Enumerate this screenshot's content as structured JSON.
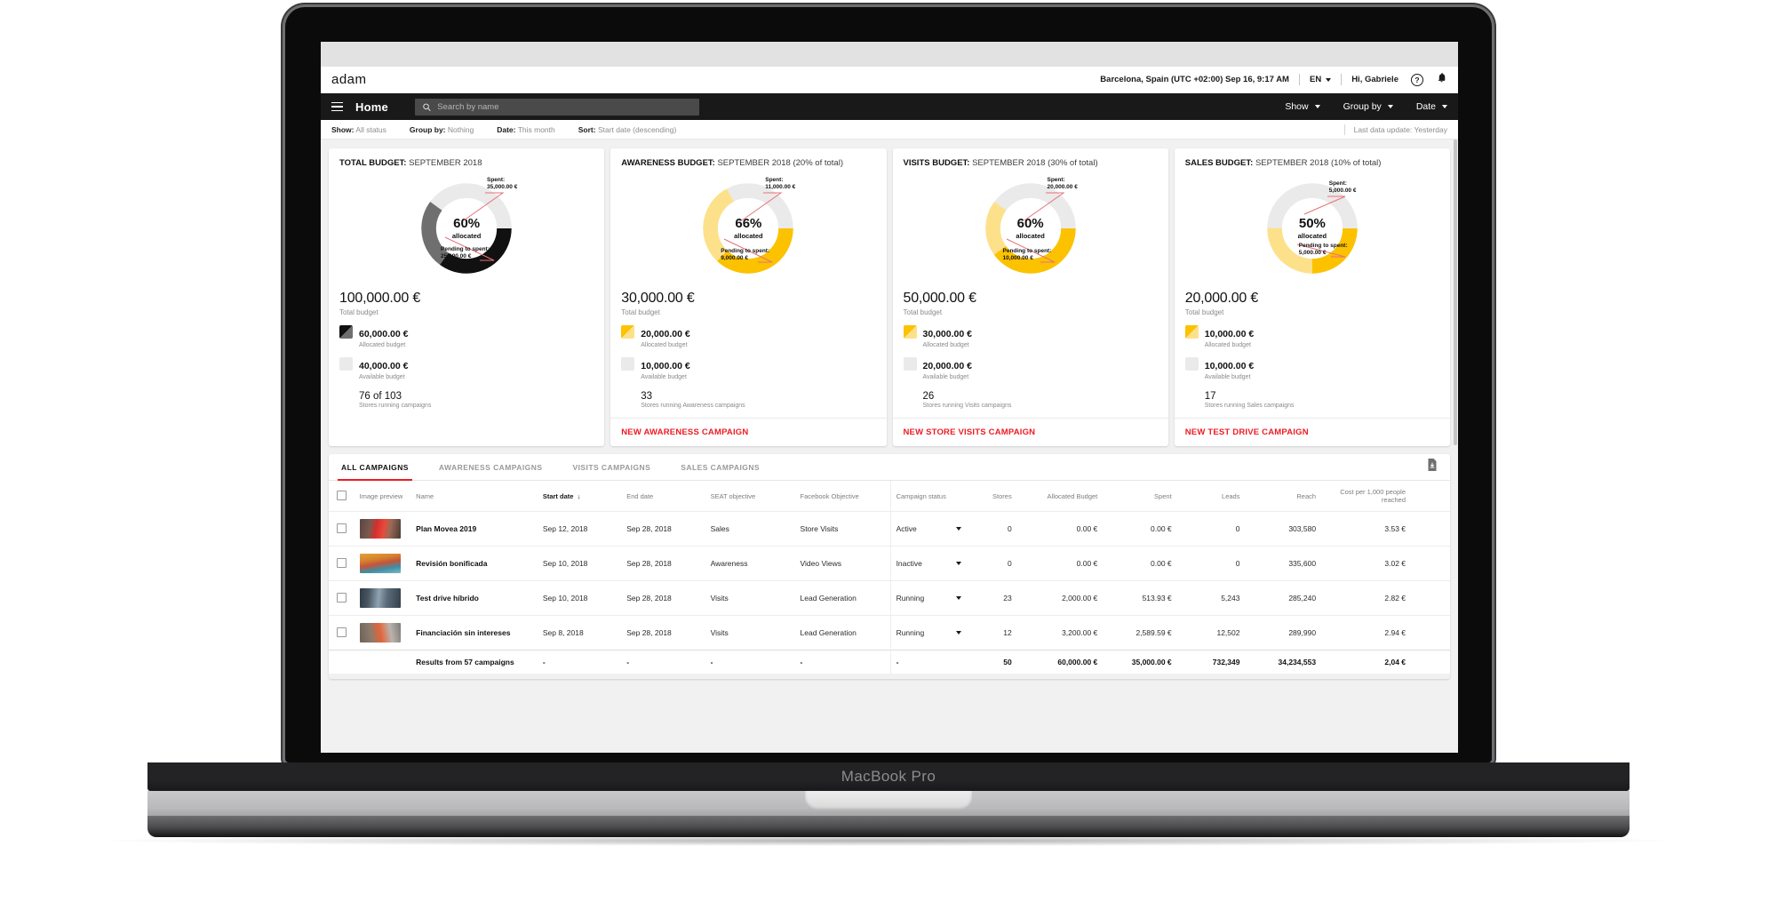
{
  "device": {
    "label": "MacBook Pro"
  },
  "brand": {
    "name": "adam"
  },
  "topbar": {
    "location_time": "Barcelona, Spain (UTC +02:00) Sep 16, 9:17 AM",
    "language": "EN",
    "greeting": "Hi, Gabriele",
    "help_icon": "question-mark-icon",
    "notifications_icon": "bell-icon"
  },
  "navbar": {
    "menu_icon": "hamburger-icon",
    "title": "Home",
    "search_placeholder": "Search by name",
    "search_value": "",
    "search_icon": "search-icon",
    "actions": [
      {
        "label": "Show"
      },
      {
        "label": "Group by"
      },
      {
        "label": "Date"
      }
    ]
  },
  "filterbar": {
    "items": [
      {
        "label": "Show:",
        "value": "All status"
      },
      {
        "label": "Group by:",
        "value": "Nothing"
      },
      {
        "label": "Date:",
        "value": "This month"
      },
      {
        "label": "Sort:",
        "value": "Start date (descending)"
      }
    ],
    "last_update": "Last data update: Yesterday"
  },
  "cards": [
    {
      "title_bold": "TOTAL BUDGET:",
      "title_rest": "SEPTEMBER 2018",
      "percent": "60%",
      "percent_sub": "allocated",
      "spent_label": "Spent:",
      "spent_value": "35,000.00 €",
      "pending_label": "Pending to spent:",
      "pending_value": "25,000.00 €",
      "total_amount": "100,000.00 €",
      "total_label": "Total budget",
      "allocated_amount": "60,000.00 €",
      "allocated_label": "Allocated budget",
      "available_amount": "40,000.00 €",
      "available_label": "Available budget",
      "stores_value": "76 of 103",
      "stores_label": "Stores running campaigns",
      "cta": "",
      "theme": "dark"
    },
    {
      "title_bold": "AWARENESS BUDGET:",
      "title_rest": "SEPTEMBER 2018 (20% of total)",
      "percent": "66%",
      "percent_sub": "allocated",
      "spent_label": "Spent:",
      "spent_value": "11,000.00 €",
      "pending_label": "Pending to spent:",
      "pending_value": "9,000.00 €",
      "total_amount": "30,000.00 €",
      "total_label": "Total budget",
      "allocated_amount": "20,000.00 €",
      "allocated_label": "Allocated budget",
      "available_amount": "10,000.00 €",
      "available_label": "Available budget",
      "stores_value": "33",
      "stores_label": "Stores running Awareness campaigns",
      "cta": "NEW AWARENESS CAMPAIGN",
      "theme": "yellow"
    },
    {
      "title_bold": "VISITS BUDGET:",
      "title_rest": "SEPTEMBER 2018 (30% of total)",
      "percent": "60%",
      "percent_sub": "allocated",
      "spent_label": "Spent:",
      "spent_value": "20,000.00 €",
      "pending_label": "Pending to spent:",
      "pending_value": "10,000.00 €",
      "total_amount": "50,000.00 €",
      "total_label": "Total budget",
      "allocated_amount": "30,000.00 €",
      "allocated_label": "Allocated budget",
      "available_amount": "20,000.00 €",
      "available_label": "Available budget",
      "stores_value": "26",
      "stores_label": "Stores running Visits campaigns",
      "cta": "NEW STORE VISITS CAMPAIGN",
      "theme": "yellow"
    },
    {
      "title_bold": "SALES BUDGET:",
      "title_rest": "SEPTEMBER 2018 (10% of total)",
      "percent": "50%",
      "percent_sub": "allocated",
      "spent_label": "Spent:",
      "spent_value": "5,000.00 €",
      "pending_label": "Pending to spent:",
      "pending_value": "5,000.00 €",
      "total_amount": "20,000.00 €",
      "total_label": "Total budget",
      "allocated_amount": "10,000.00 €",
      "allocated_label": "Allocated budget",
      "available_amount": "10,000.00 €",
      "available_label": "Available budget",
      "stores_value": "17",
      "stores_label": "Stores running Sales campaigns",
      "cta": "NEW TEST DRIVE CAMPAIGN",
      "theme": "yellow"
    }
  ],
  "chart_data": [
    {
      "type": "pie",
      "title": "TOTAL BUDGET: SEPTEMBER 2018",
      "labels": [
        "Spent",
        "Pending to spent",
        "Available"
      ],
      "values": [
        35000,
        25000,
        40000
      ],
      "value_labels": [
        "35,000.00 €",
        "25,000.00 €",
        "40,000.00 €"
      ],
      "colors": [
        "#111111",
        "#6f6f6f",
        "#eaeaea"
      ],
      "center_label": "60% allocated",
      "total": 100000
    },
    {
      "type": "pie",
      "title": "AWARENESS BUDGET: SEPTEMBER 2018 (20% of total)",
      "labels": [
        "Spent",
        "Pending to spent",
        "Available"
      ],
      "values": [
        11000,
        9000,
        10000
      ],
      "value_labels": [
        "11,000.00 €",
        "9,000.00 €",
        "10,000.00 €"
      ],
      "colors": [
        "#fcc200",
        "#fde18a",
        "#eaeaea"
      ],
      "center_label": "66% allocated",
      "total": 30000
    },
    {
      "type": "pie",
      "title": "VISITS BUDGET: SEPTEMBER 2018 (30% of total)",
      "labels": [
        "Spent",
        "Pending to spent",
        "Available"
      ],
      "values": [
        20000,
        10000,
        20000
      ],
      "value_labels": [
        "20,000.00 €",
        "10,000.00 €",
        "20,000.00 €"
      ],
      "colors": [
        "#fcc200",
        "#fde18a",
        "#eaeaea"
      ],
      "center_label": "60% allocated",
      "total": 50000
    },
    {
      "type": "pie",
      "title": "SALES BUDGET: SEPTEMBER 2018 (10% of total)",
      "labels": [
        "Spent",
        "Pending to spent",
        "Available"
      ],
      "values": [
        5000,
        5000,
        10000
      ],
      "value_labels": [
        "5,000.00 €",
        "5,000.00 €",
        "10,000.00 €"
      ],
      "colors": [
        "#fcc200",
        "#fde18a",
        "#eaeaea"
      ],
      "center_label": "50% allocated",
      "total": 20000
    }
  ],
  "table": {
    "tabs": [
      {
        "label": "ALL CAMPAIGNS",
        "active": true
      },
      {
        "label": "AWARENESS CAMPAIGNS",
        "active": false
      },
      {
        "label": "VISITS CAMPAIGNS",
        "active": false
      },
      {
        "label": "SALES CAMPAIGNS",
        "active": false
      }
    ],
    "export_icon": "download-file-icon",
    "columns": [
      "Image preview",
      "Name",
      "Start date",
      "End date",
      "SEAT objective",
      "Facebook Objective",
      "Campaign status",
      "Stores",
      "Allocated Budget",
      "Spent",
      "Leads",
      "Reach",
      "Cost per 1,000 people reached"
    ],
    "sort_column": "Start date",
    "sort_direction": "descending",
    "rows": [
      {
        "name": "Plan Movea 2019",
        "start_date": "Sep 12, 2018",
        "end_date": "Sep 28, 2018",
        "seat_objective": "Sales",
        "facebook_objective": "Store Visits",
        "status": "Active",
        "stores": "0",
        "allocated_budget": "0.00 €",
        "spent": "0.00 €",
        "leads": "0",
        "reach": "303,580",
        "cost_per_1000": "3.53 €"
      },
      {
        "name": "Revisión bonificada",
        "start_date": "Sep 10, 2018",
        "end_date": "Sep 28, 2018",
        "seat_objective": "Awareness",
        "facebook_objective": "Video Views",
        "status": "Inactive",
        "stores": "0",
        "allocated_budget": "0.00 €",
        "spent": "0.00 €",
        "leads": "0",
        "reach": "335,600",
        "cost_per_1000": "3.02 €"
      },
      {
        "name": "Test drive híbrido",
        "start_date": "Sep 10, 2018",
        "end_date": "Sep 28, 2018",
        "seat_objective": "Visits",
        "facebook_objective": "Lead Generation",
        "status": "Running",
        "stores": "23",
        "allocated_budget": "2,000.00 €",
        "spent": "513.93 €",
        "leads": "5,243",
        "reach": "285,240",
        "cost_per_1000": "2.82 €"
      },
      {
        "name": "Financiación sin intereses",
        "start_date": "Sep 8, 2018",
        "end_date": "Sep 28, 2018",
        "seat_objective": "Visits",
        "facebook_objective": "Lead Generation",
        "status": "Running",
        "stores": "12",
        "allocated_budget": "3,200.00 €",
        "spent": "2,589.59 €",
        "leads": "12,502",
        "reach": "289,990",
        "cost_per_1000": "2.94 €"
      }
    ],
    "totals": {
      "label": "Results from 57 campaigns",
      "start_date": "-",
      "end_date": "-",
      "seat_objective": "-",
      "facebook_objective": "-",
      "status": "-",
      "stores": "50",
      "allocated_budget": "60,000.00 €",
      "spent": "35,000.00 €",
      "leads": "732,349",
      "reach": "34,234,553",
      "cost_per_1000": "2,04 €"
    }
  }
}
